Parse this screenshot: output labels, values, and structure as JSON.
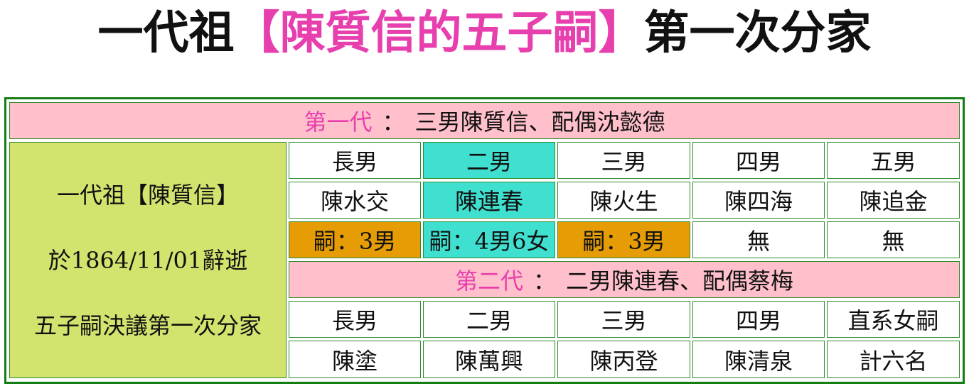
{
  "title": {
    "prefix": "一代祖",
    "highlight": "【陳質信的五子嗣】",
    "suffix": "第一次分家"
  },
  "generation1": {
    "label": "第一代",
    "sep": "：",
    "text": "三男陳質信、配偶沈懿德"
  },
  "ancestor": {
    "line1": "一代祖【陳質信】",
    "line2": "於1864/11/01辭逝",
    "line3": "五子嗣決議第一次分家"
  },
  "sons": {
    "ranks": [
      "長男",
      "二男",
      "三男",
      "四男",
      "五男"
    ],
    "names": [
      "陳水交",
      "陳連春",
      "陳火生",
      "陳四海",
      "陳追金"
    ],
    "heirs": [
      "嗣：3男",
      "嗣：4男6女",
      "嗣：3男",
      "無",
      "無"
    ]
  },
  "generation2": {
    "label": "第二代",
    "sep": "：",
    "text": "二男陳連春、配偶蔡梅"
  },
  "grandsons": {
    "ranks": [
      "長男",
      "二男",
      "三男",
      "四男",
      "直系女嗣"
    ],
    "names": [
      "陳塗",
      "陳萬興",
      "陳丙登",
      "陳清泉",
      "計六名"
    ]
  },
  "colors": {
    "title_highlight": "#e83fae",
    "header_bg": "#ffc0cb",
    "ancestor_bg": "#d4e36e",
    "highlight_column": "#40e0d0",
    "heir_bg": "#e59c05",
    "border": "#137e13"
  }
}
